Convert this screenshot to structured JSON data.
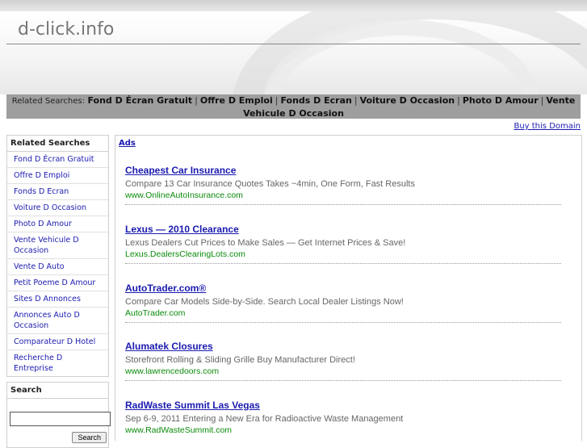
{
  "site": {
    "title": "d-click.info"
  },
  "related_bar": {
    "label": "Related Searches:",
    "items": [
      "Fond D Écran Gratuit",
      "Offre D Emploi",
      "Fonds D Ecran",
      "Voiture D Occasion",
      "Photo D Amour",
      "Vente Vehicule D Occasion"
    ],
    "separator": "|"
  },
  "buy_domain": "Buy this Domain",
  "sidebar": {
    "heading": "Related Searches",
    "items": [
      "Fond D Écran Gratuit",
      "Offre D Emploi",
      "Fonds D Ecran",
      "Voiture D Occasion",
      "Photo D Amour",
      "Vente Vehicule D Occasion",
      "Vente D Auto",
      "Petit Poeme D Amour",
      "Sites D Annonces",
      "Annonces Auto D Occasion",
      "Comparateur D Hotel",
      "Recherche D Entreprise"
    ]
  },
  "search": {
    "heading": "Search",
    "button": "Search"
  },
  "ads": {
    "label": "Ads",
    "items": [
      {
        "title": "Cheapest Car Insurance",
        "desc": "Compare 13 Car Insurance Quotes Takes ~4min, One Form, Fast Results",
        "url": "www.OnlineAutoInsurance.com"
      },
      {
        "title": "Lexus — 2010 Clearance",
        "desc": "Lexus Dealers Cut Prices to Make Sales — Get Internet Prices & Save!",
        "url": "Lexus.DealersClearingLots.com"
      },
      {
        "title": "AutoTrader.com®",
        "desc": "Compare Car Models Side-by-Side. Search Local Dealer Listings Now!",
        "url": "AutoTrader.com"
      },
      {
        "title": "Alumatek Closures",
        "desc": "Storefront Rolling & Sliding Grille Buy Manufacturer Direct!",
        "url": "www.lawrencedoors.com"
      },
      {
        "title": "RadWaste Summit Las Vegas",
        "desc": "Sep 6-9, 2011 Entering a New Era for Radioactive Waste Management",
        "url": "www.RadWasteSummit.com"
      }
    ]
  },
  "colors": {
    "link": "#1a1ab0",
    "url_green": "#0a8a0a",
    "bar_gray": "#9e9e9e"
  }
}
